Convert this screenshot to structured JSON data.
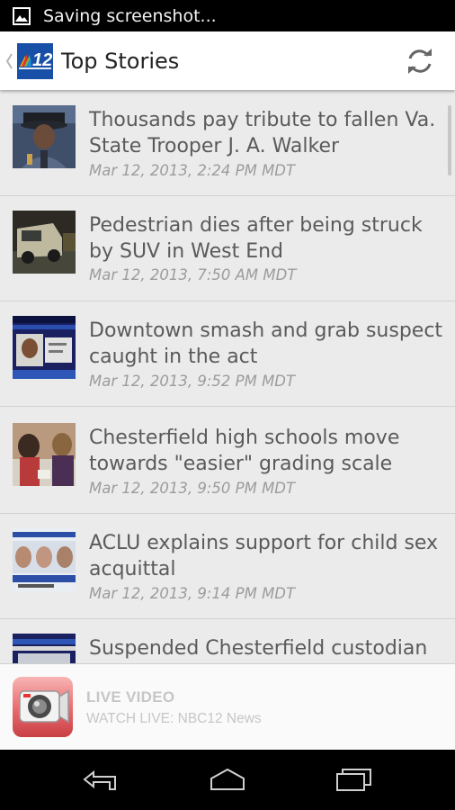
{
  "status_bar": {
    "text": "Saving screenshot...",
    "icon": "image-icon"
  },
  "action_bar": {
    "logo_text": "12",
    "title": "Top Stories",
    "refresh_icon": "refresh-icon"
  },
  "stories": [
    {
      "headline": "Thousands pay tribute to fallen Va. State Trooper J. A. Walker",
      "time": "Mar 12, 2013, 2:24 PM MDT"
    },
    {
      "headline": "Pedestrian dies after being struck by SUV in West End",
      "time": "Mar 12, 2013, 7:50 AM MDT"
    },
    {
      "headline": "Downtown smash and grab suspect caught in the act",
      "time": "Mar 12, 2013, 9:52 PM MDT"
    },
    {
      "headline": "Chesterfield high schools move towards \"easier\" grading scale",
      "time": "Mar 12, 2013, 9:50 PM MDT"
    },
    {
      "headline": "ACLU explains support for child sex acquittal",
      "time": "Mar 12, 2013, 9:14 PM MDT"
    },
    {
      "headline": "Suspended Chesterfield custodian",
      "time": ""
    }
  ],
  "live_video": {
    "title": "LIVE VIDEO",
    "subtitle": "WATCH LIVE: NBC12 News",
    "icon": "camera-icon"
  },
  "nav": {
    "back_icon": "back-icon",
    "home_icon": "home-icon",
    "recents_icon": "recents-icon"
  },
  "colors": {
    "list_background": "#ebebeb",
    "headline": "#5a5a5a",
    "timestamp": "#9c9c9c",
    "logo_blue": "#1750a6"
  }
}
